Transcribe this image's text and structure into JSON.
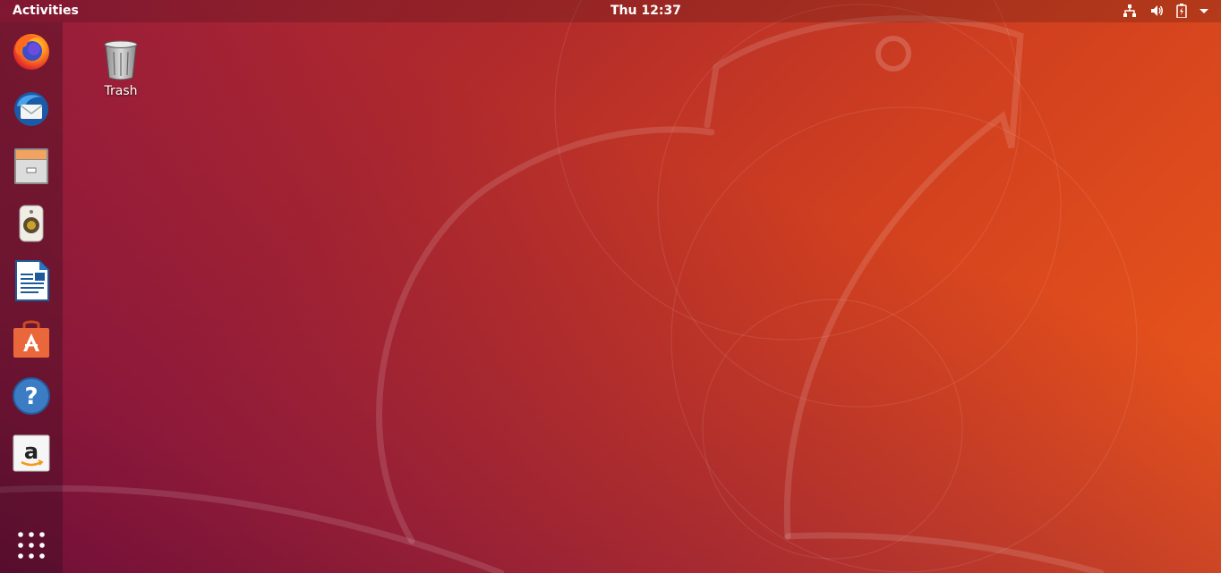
{
  "top_bar": {
    "activities_label": "Activities",
    "clock": "Thu 12:37",
    "tray_icons": [
      "network-icon",
      "volume-icon",
      "battery-icon",
      "system-menu-arrow-icon"
    ]
  },
  "dock": {
    "items": [
      {
        "name": "Firefox",
        "icon": "firefox-icon"
      },
      {
        "name": "Thunderbird",
        "icon": "thunderbird-icon"
      },
      {
        "name": "Files",
        "icon": "files-icon"
      },
      {
        "name": "Rhythmbox",
        "icon": "rhythmbox-icon"
      },
      {
        "name": "LibreOffice Writer",
        "icon": "writer-icon"
      },
      {
        "name": "Ubuntu Software",
        "icon": "software-icon"
      },
      {
        "name": "Help",
        "icon": "help-icon"
      },
      {
        "name": "Amazon",
        "icon": "amazon-icon"
      }
    ],
    "show_apps_icon": "show-applications-icon"
  },
  "desktop": {
    "icons": [
      {
        "label": "Trash",
        "icon": "trash-icon"
      }
    ]
  },
  "colors": {
    "wallpaper_start": "#9c1e3a",
    "wallpaper_end": "#ee5a1a",
    "accent_orange": "#e95420"
  }
}
